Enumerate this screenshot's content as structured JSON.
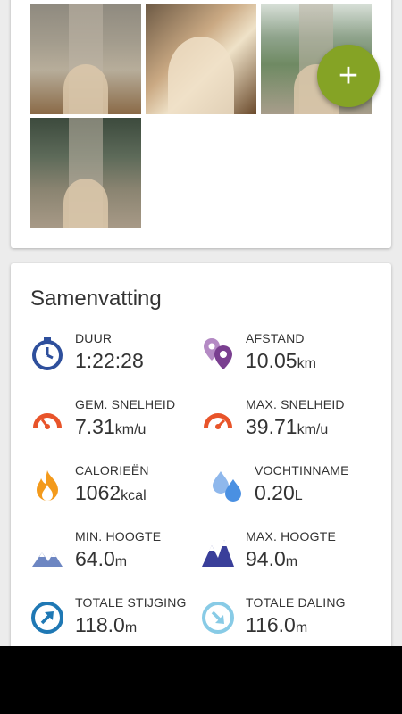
{
  "fab": {
    "label": "+"
  },
  "summary": {
    "title": "Samenvatting",
    "stats": [
      {
        "label": "DUUR",
        "value": "1:22:28",
        "unit": ""
      },
      {
        "label": "AFSTAND",
        "value": "10.05",
        "unit": "km"
      },
      {
        "label": "GEM. SNELHEID",
        "value": "7.31",
        "unit": "km/u"
      },
      {
        "label": "MAX. SNELHEID",
        "value": "39.71",
        "unit": "km/u"
      },
      {
        "label": "CALORIEËN",
        "value": "1062",
        "unit": "kcal"
      },
      {
        "label": "VOCHTINNAME",
        "value": "0.20",
        "unit": "L"
      },
      {
        "label": "MIN. HOOGTE",
        "value": "64.0",
        "unit": "m"
      },
      {
        "label": "MAX. HOOGTE",
        "value": "94.0",
        "unit": "m"
      },
      {
        "label": "TOTALE STIJGING",
        "value": "118.0",
        "unit": "m"
      },
      {
        "label": "TOTALE DALING",
        "value": "116.0",
        "unit": "m"
      }
    ]
  },
  "colors": {
    "accent_green": "#85a325",
    "duration_blue": "#2e4f9c",
    "location_purple": "#7a3f90",
    "speed_orange": "#e8542a",
    "calorie_orange": "#f39a1c",
    "water_blue": "#4a90e2",
    "altitude_min": "#6d86c2",
    "altitude_max": "#3a3f9a",
    "ascent_blue": "#1f78b4",
    "descent_blue": "#88cbe6"
  }
}
